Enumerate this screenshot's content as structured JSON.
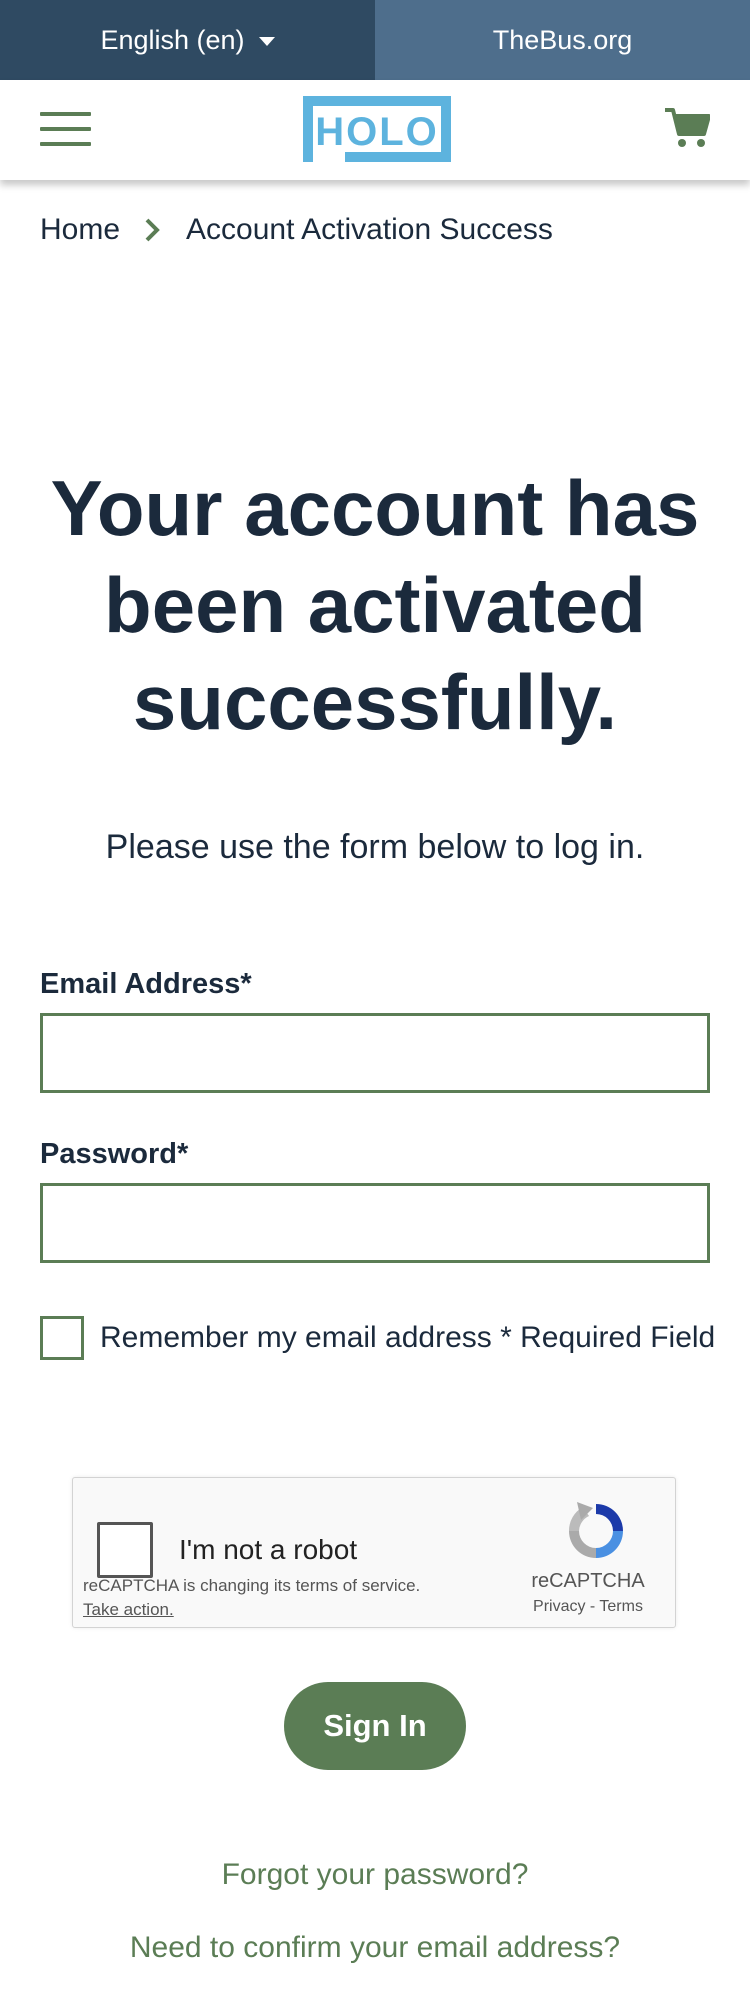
{
  "topbar": {
    "language_label": "English (en)",
    "site_link": "TheBus.org",
    "bg_left": "#2f4a62",
    "bg_right": "#4e6e8c"
  },
  "header": {
    "logo_text": "HOLO",
    "menu_icon": "hamburger-menu-icon",
    "cart_icon": "shopping-cart-icon",
    "accent": "#5b7d55",
    "logo_color": "#5db3de"
  },
  "breadcrumb": {
    "home": "Home",
    "separator_icon": "chevron-right-icon",
    "current": "Account Activation Success"
  },
  "main": {
    "headline": "Your account has been activated successfully.",
    "subline": "Please use the form below to log in."
  },
  "form": {
    "email_label": "Email Address*",
    "email_value": "",
    "password_label": "Password*",
    "password_value": "",
    "remember_label": "Remember my email address * Required Field",
    "remember_checked": false
  },
  "recaptcha": {
    "checkbox_label": "I'm not a robot",
    "notice": "reCAPTCHA is changing its terms of service.",
    "action_link": "Take action.",
    "brand": "reCAPTCHA",
    "privacy": "Privacy",
    "dash": "-",
    "terms": "Terms"
  },
  "actions": {
    "sign_in": "Sign In",
    "forgot_password": "Forgot your password?",
    "confirm_email": "Need to confirm your email address?"
  }
}
